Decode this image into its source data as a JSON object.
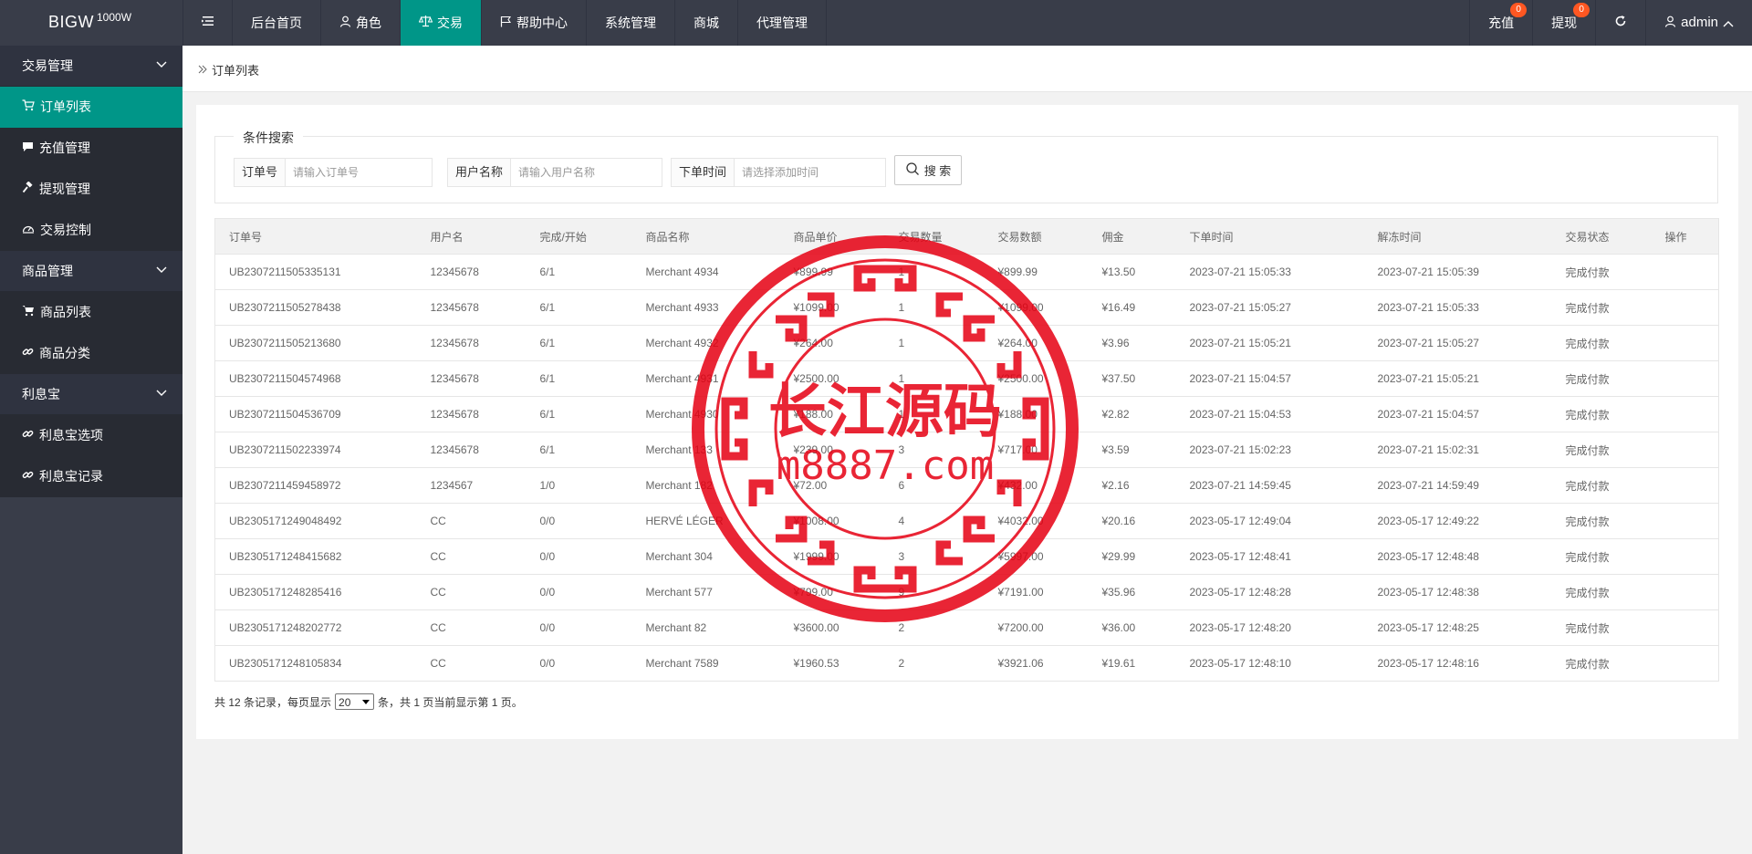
{
  "logo": {
    "main": "BIGW",
    "sup": "1000W"
  },
  "nav": [
    {
      "label": "后台首页",
      "icon": ""
    },
    {
      "label": "角色",
      "icon": "user-icon"
    },
    {
      "label": "交易",
      "icon": "scale-icon",
      "active": true
    },
    {
      "label": "帮助中心",
      "icon": "flag-icon"
    },
    {
      "label": "系统管理",
      "icon": ""
    },
    {
      "label": "商城",
      "icon": ""
    },
    {
      "label": "代理管理",
      "icon": ""
    }
  ],
  "right_nav": {
    "recharge": "充值",
    "recharge_badge": "0",
    "withdraw": "提现",
    "withdraw_badge": "0",
    "user": "admin"
  },
  "sidebar": {
    "group1": "交易管理",
    "group1_items": [
      "订单列表",
      "充值管理",
      "提现管理",
      "交易控制"
    ],
    "group2": "商品管理",
    "group2_items": [
      "商品列表",
      "商品分类"
    ],
    "group3": "利息宝",
    "group3_items": [
      "利息宝选项",
      "利息宝记录"
    ]
  },
  "breadcrumb": "订单列表",
  "search": {
    "legend": "条件搜索",
    "order_label": "订单号",
    "order_placeholder": "请输入订单号",
    "user_label": "用户名称",
    "user_placeholder": "请输入用户名称",
    "time_label": "下单时间",
    "time_placeholder": "请选择添加时间",
    "button": "搜 索"
  },
  "table": {
    "headers": [
      "订单号",
      "用户名",
      "完成/开始",
      "商品名称",
      "商品单价",
      "交易数量",
      "交易数额",
      "佣金",
      "下单时间",
      "解冻时间",
      "交易状态",
      "操作"
    ],
    "rows": [
      [
        "UB2307211505335131",
        "12345678",
        "6/1",
        "Merchant 4934",
        "¥899.99",
        "1",
        "¥899.99",
        "¥13.50",
        "2023-07-21 15:05:33",
        "2023-07-21 15:05:39",
        "完成付款",
        ""
      ],
      [
        "UB2307211505278438",
        "12345678",
        "6/1",
        "Merchant 4933",
        "¥1099.00",
        "1",
        "¥1099.00",
        "¥16.49",
        "2023-07-21 15:05:27",
        "2023-07-21 15:05:33",
        "完成付款",
        ""
      ],
      [
        "UB2307211505213680",
        "12345678",
        "6/1",
        "Merchant 4932",
        "¥264.00",
        "1",
        "¥264.00",
        "¥3.96",
        "2023-07-21 15:05:21",
        "2023-07-21 15:05:27",
        "完成付款",
        ""
      ],
      [
        "UB2307211504574968",
        "12345678",
        "6/1",
        "Merchant 4931",
        "¥2500.00",
        "1",
        "¥2500.00",
        "¥37.50",
        "2023-07-21 15:04:57",
        "2023-07-21 15:05:21",
        "完成付款",
        ""
      ],
      [
        "UB2307211504536709",
        "12345678",
        "6/1",
        "Merchant 4930",
        "¥188.00",
        "1",
        "¥188.00",
        "¥2.82",
        "2023-07-21 15:04:53",
        "2023-07-21 15:04:57",
        "完成付款",
        ""
      ],
      [
        "UB2307211502233974",
        "12345678",
        "6/1",
        "Merchant 133",
        "¥239.00",
        "3",
        "¥717.00",
        "¥3.59",
        "2023-07-21 15:02:23",
        "2023-07-21 15:02:31",
        "完成付款",
        ""
      ],
      [
        "UB2307211459458972",
        "1234567",
        "1/0",
        "Merchant 182",
        "¥72.00",
        "6",
        "¥432.00",
        "¥2.16",
        "2023-07-21 14:59:45",
        "2023-07-21 14:59:49",
        "完成付款",
        ""
      ],
      [
        "UB2305171249048492",
        "CC",
        "0/0",
        "HERVÉ LÉGER",
        "¥1008.00",
        "4",
        "¥4032.00",
        "¥20.16",
        "2023-05-17 12:49:04",
        "2023-05-17 12:49:22",
        "完成付款",
        ""
      ],
      [
        "UB2305171248415682",
        "CC",
        "0/0",
        "Merchant 304",
        "¥1999.00",
        "3",
        "¥5997.00",
        "¥29.99",
        "2023-05-17 12:48:41",
        "2023-05-17 12:48:48",
        "完成付款",
        ""
      ],
      [
        "UB2305171248285416",
        "CC",
        "0/0",
        "Merchant 577",
        "¥799.00",
        "9",
        "¥7191.00",
        "¥35.96",
        "2023-05-17 12:48:28",
        "2023-05-17 12:48:38",
        "完成付款",
        ""
      ],
      [
        "UB2305171248202772",
        "CC",
        "0/0",
        "Merchant 82",
        "¥3600.00",
        "2",
        "¥7200.00",
        "¥36.00",
        "2023-05-17 12:48:20",
        "2023-05-17 12:48:25",
        "完成付款",
        ""
      ],
      [
        "UB2305171248105834",
        "CC",
        "0/0",
        "Merchant 7589",
        "¥1960.53",
        "2",
        "¥3921.06",
        "¥19.61",
        "2023-05-17 12:48:10",
        "2023-05-17 12:48:16",
        "完成付款",
        ""
      ]
    ]
  },
  "pager": {
    "prefix": "共 12 条记录，每页显示",
    "per_page": "20",
    "suffix": "条，共 1 页当前显示第 1 页。"
  },
  "watermark": {
    "line1": "长江源码",
    "line2": "m8887.com",
    "color": "#e60012"
  }
}
